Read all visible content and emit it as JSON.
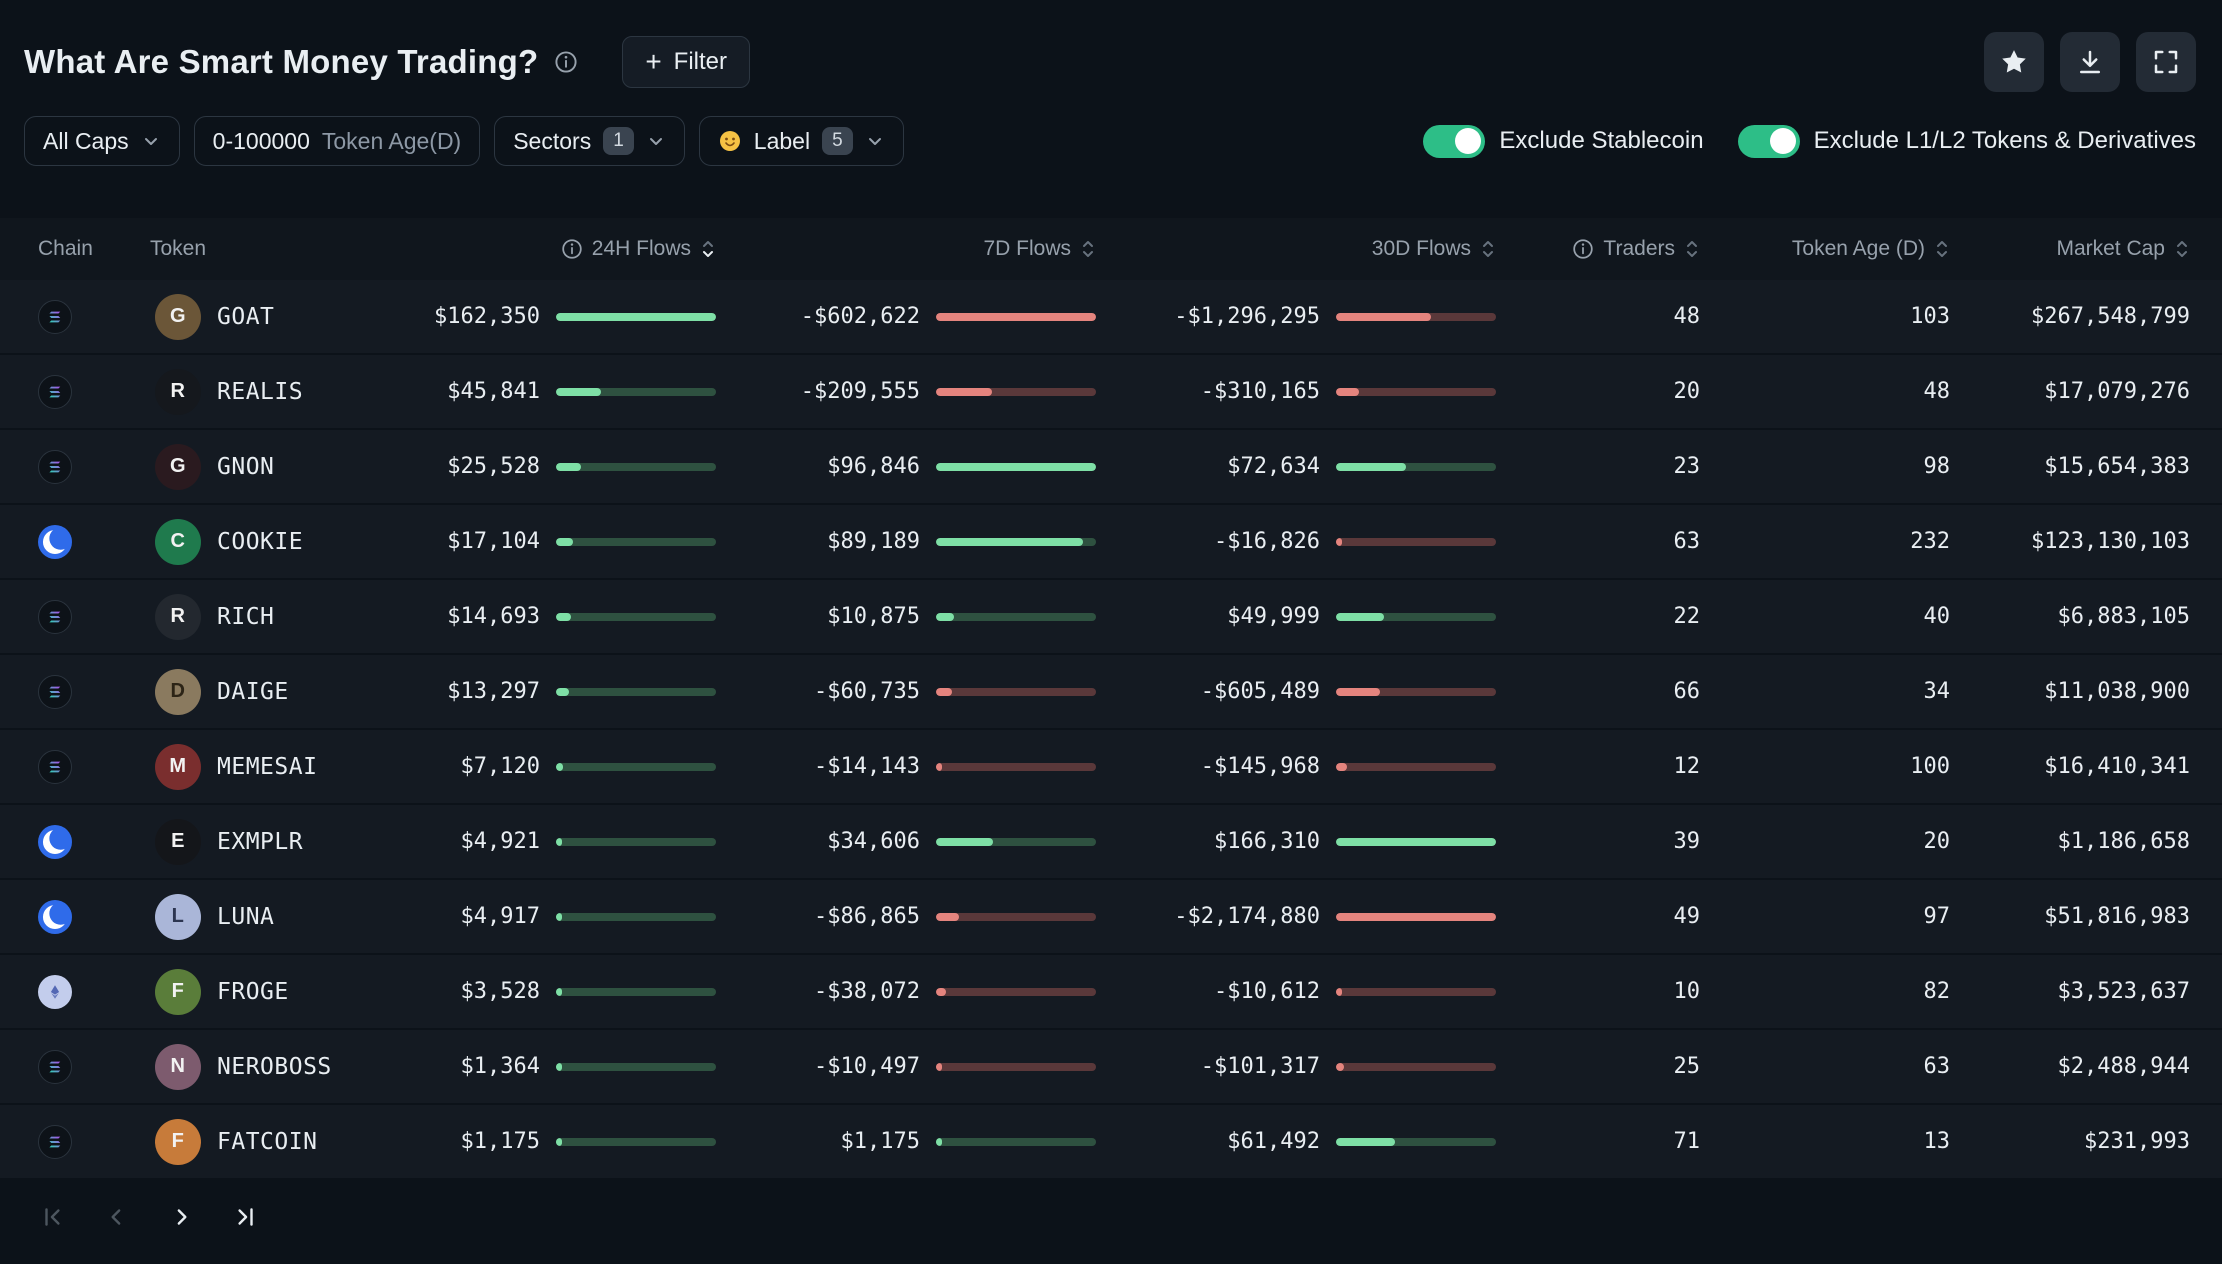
{
  "header": {
    "title": "What Are Smart Money Trading?",
    "filter_button_label": "Filter"
  },
  "filters": {
    "caps_label": "All Caps",
    "token_age_value": "0-100000",
    "token_age_placeholder": "Token Age(D)",
    "sectors_label": "Sectors",
    "sectors_count": "1",
    "label_icon": "smiley-face-icon",
    "label_label": "Label",
    "label_count": "5"
  },
  "toggles": [
    {
      "label": "Exclude Stablecoin",
      "on": true
    },
    {
      "label": "Exclude L1/L2 Tokens & Derivatives",
      "on": true
    }
  ],
  "table": {
    "columns": [
      {
        "id": "chain",
        "label": "Chain"
      },
      {
        "id": "token",
        "label": "Token"
      },
      {
        "id": "f24",
        "label": "24H Flows",
        "info": true,
        "sortable": true,
        "sorted": "desc"
      },
      {
        "id": "f7",
        "label": "7D Flows",
        "sortable": true
      },
      {
        "id": "f30",
        "label": "30D Flows",
        "sortable": true
      },
      {
        "id": "traders",
        "label": "Traders",
        "info": true,
        "sortable": true
      },
      {
        "id": "age",
        "label": "Token Age (D)",
        "sortable": true
      },
      {
        "id": "mcap",
        "label": "Market Cap",
        "sortable": true
      }
    ],
    "rows": [
      {
        "chain": "solana",
        "token": "GOAT",
        "avatar_color": "#6b5638",
        "f24": 162350,
        "f7": -602622,
        "f30": -1296295,
        "traders": 48,
        "age": 103,
        "mcap": 267548799
      },
      {
        "chain": "solana",
        "token": "REALIS",
        "avatar_color": "#15181d",
        "f24": 45841,
        "f7": -209555,
        "f30": -310165,
        "traders": 20,
        "age": 48,
        "mcap": 17079276
      },
      {
        "chain": "solana",
        "token": "GNON",
        "avatar_color": "#2a1a1f",
        "f24": 25528,
        "f7": 96846,
        "f30": 72634,
        "traders": 23,
        "age": 98,
        "mcap": 15654383
      },
      {
        "chain": "base",
        "token": "COOKIE",
        "avatar_color": "#1f7a4d",
        "f24": 17104,
        "f7": 89189,
        "f30": -16826,
        "traders": 63,
        "age": 232,
        "mcap": 123130103
      },
      {
        "chain": "solana",
        "token": "RICH",
        "avatar_color": "#23282f",
        "f24": 14693,
        "f7": 10875,
        "f30": 49999,
        "traders": 22,
        "age": 40,
        "mcap": 6883105
      },
      {
        "chain": "solana",
        "token": "DAIGE",
        "avatar_color": "#8a7a5f",
        "avatar_fg": "#2c2416",
        "f24": 13297,
        "f7": -60735,
        "f30": -605489,
        "traders": 66,
        "age": 34,
        "mcap": 11038900
      },
      {
        "chain": "solana",
        "token": "MEMESAI",
        "avatar_color": "#7a2e2e",
        "f24": 7120,
        "f7": -14143,
        "f30": -145968,
        "traders": 12,
        "age": 100,
        "mcap": 16410341
      },
      {
        "chain": "base",
        "token": "EXMPLR",
        "avatar_color": "#14161a",
        "f24": 4921,
        "f7": 34606,
        "f30": 166310,
        "traders": 39,
        "age": 20,
        "mcap": 1186658
      },
      {
        "chain": "base",
        "token": "LUNA",
        "avatar_color": "#aab6d8",
        "avatar_fg": "#2c3550",
        "f24": 4917,
        "f7": -86865,
        "f30": -2174880,
        "traders": 49,
        "age": 97,
        "mcap": 51816983
      },
      {
        "chain": "ethereum",
        "token": "FROGE",
        "avatar_color": "#5a7d3a",
        "f24": 3528,
        "f7": -38072,
        "f30": -10612,
        "traders": 10,
        "age": 82,
        "mcap": 3523637
      },
      {
        "chain": "solana",
        "token": "NEROBOSS",
        "avatar_color": "#7d5b6e",
        "f24": 1364,
        "f7": -10497,
        "f30": -101317,
        "traders": 25,
        "age": 63,
        "mcap": 2488944
      },
      {
        "chain": "solana",
        "token": "FATCOIN",
        "avatar_color": "#c77b3a",
        "f24": 1175,
        "f7": 1175,
        "f30": 61492,
        "traders": 71,
        "age": 13,
        "mcap": 231993
      }
    ]
  },
  "pagination": {
    "first_enabled": false,
    "previous_enabled": false,
    "next_enabled": true,
    "last_enabled": true
  },
  "colors": {
    "positive": "#7edfa6",
    "positive_track": "#2e5140",
    "negative": "#e4847e",
    "negative_track": "#5a383a",
    "toggle_on": "#2dbe87"
  }
}
